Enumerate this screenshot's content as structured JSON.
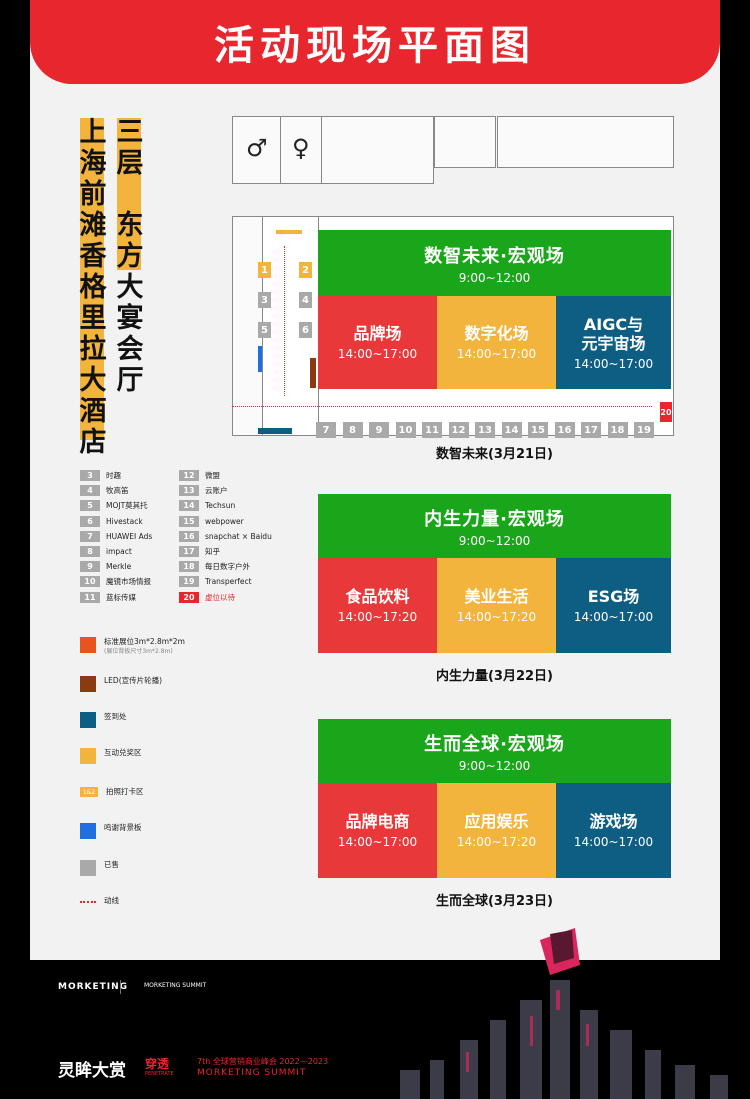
{
  "banner": {
    "title": "活动现场平面图"
  },
  "venue": {
    "hotel": [
      "上",
      "海",
      "前",
      "滩",
      "香",
      "格",
      "里",
      "拉",
      "大",
      "酒",
      "店"
    ],
    "hall": [
      "三",
      "层",
      "",
      "东",
      "方",
      "大",
      "宴",
      "会",
      "厅"
    ]
  },
  "floorplan": {
    "booths_left": [
      {
        "no": "1",
        "color": "#f3b43d"
      },
      {
        "no": "2",
        "color": "#f3b43d"
      },
      {
        "no": "3",
        "color": "#a9a9a9"
      },
      {
        "no": "4",
        "color": "#a9a9a9"
      },
      {
        "no": "5",
        "color": "#a9a9a9"
      },
      {
        "no": "6",
        "color": "#a9a9a9"
      }
    ],
    "booths_bottom": [
      "7",
      "8",
      "9",
      "10",
      "11",
      "12",
      "13",
      "14",
      "15",
      "16",
      "17",
      "18",
      "19"
    ],
    "booth_20": "20"
  },
  "days": [
    {
      "main": {
        "name": "数智未来·宏观场",
        "time": "9:00~12:00"
      },
      "subs": [
        {
          "name": "品牌场",
          "time": "14:00~17:00"
        },
        {
          "name": "数字化场",
          "time": "14:00~17:00"
        },
        {
          "name": "AIGC与\n元宇宙场",
          "time": "14:00~17:00"
        }
      ],
      "caption": "数智未来(3月21日)"
    },
    {
      "main": {
        "name": "内生力量·宏观场",
        "time": "9:00~12:00"
      },
      "subs": [
        {
          "name": "食品饮料",
          "time": "14:00~17:20"
        },
        {
          "name": "美业生活",
          "time": "14:00~17:20"
        },
        {
          "name": "ESG场",
          "time": "14:00~17:00"
        }
      ],
      "caption": "内生力量(3月22日)"
    },
    {
      "main": {
        "name": "生而全球·宏观场",
        "time": "9:00~12:00"
      },
      "subs": [
        {
          "name": "品牌电商",
          "time": "14:00~17:00"
        },
        {
          "name": "应用娱乐",
          "time": "14:00~17:20"
        },
        {
          "name": "游戏场",
          "time": "14:00~17:00"
        }
      ],
      "caption": "生而全球(3月23日)"
    }
  ],
  "booth_legend": [
    {
      "no": "3",
      "name": "时趣"
    },
    {
      "no": "12",
      "name": "微盟"
    },
    {
      "no": "4",
      "name": "牧高笛"
    },
    {
      "no": "13",
      "name": "云账户"
    },
    {
      "no": "5",
      "name": "MOJT莫其托"
    },
    {
      "no": "14",
      "name": "Techsun"
    },
    {
      "no": "6",
      "name": "Hivestack"
    },
    {
      "no": "15",
      "name": "webpower"
    },
    {
      "no": "7",
      "name": "HUAWEI Ads"
    },
    {
      "no": "16",
      "name": "snapchat × Baidu"
    },
    {
      "no": "8",
      "name": "impact"
    },
    {
      "no": "17",
      "name": "知乎"
    },
    {
      "no": "9",
      "name": "Merkle"
    },
    {
      "no": "18",
      "name": "每日数字户外"
    },
    {
      "no": "10",
      "name": "魔镜市场情报"
    },
    {
      "no": "19",
      "name": "Transperfect"
    },
    {
      "no": "11",
      "name": "蓝标传媒"
    },
    {
      "no": "20",
      "name": "虚位以待"
    }
  ],
  "keys": [
    {
      "label": "标准展位3m*2.8m*2m",
      "sub": "(展位背板尺寸3m*2.8m)",
      "color": "#e8531e"
    },
    {
      "label": "LED(宣传片轮播)",
      "color": "#8a3b12"
    },
    {
      "label": "签到处",
      "color": "#0e5e84"
    },
    {
      "label": "互动兑奖区",
      "color": "#f3b43d"
    },
    {
      "label": "拍照打卡区",
      "badge": "1&2",
      "color": "#f3b43d"
    },
    {
      "label": "鸣谢背景板",
      "color": "#1e6fe0"
    },
    {
      "label": "已售",
      "color": "#a9a9a9"
    },
    {
      "label": "动线",
      "color": "#e8262d"
    }
  ],
  "footer": {
    "brand1": "MORKETING",
    "brand2": "MORKETING SUMMIT",
    "award": "灵眸大赏",
    "penetrate": "穿透",
    "penetrate_en": "PENETRATE",
    "summit_cn": "7th 全球营销商业峰会 2022—2023",
    "summit_en": "MORKETING SUMMIT"
  },
  "colors": {
    "green": "#1aa61a",
    "red": "#e8383a",
    "orange": "#f3b43d",
    "blue": "#0e5e84"
  }
}
